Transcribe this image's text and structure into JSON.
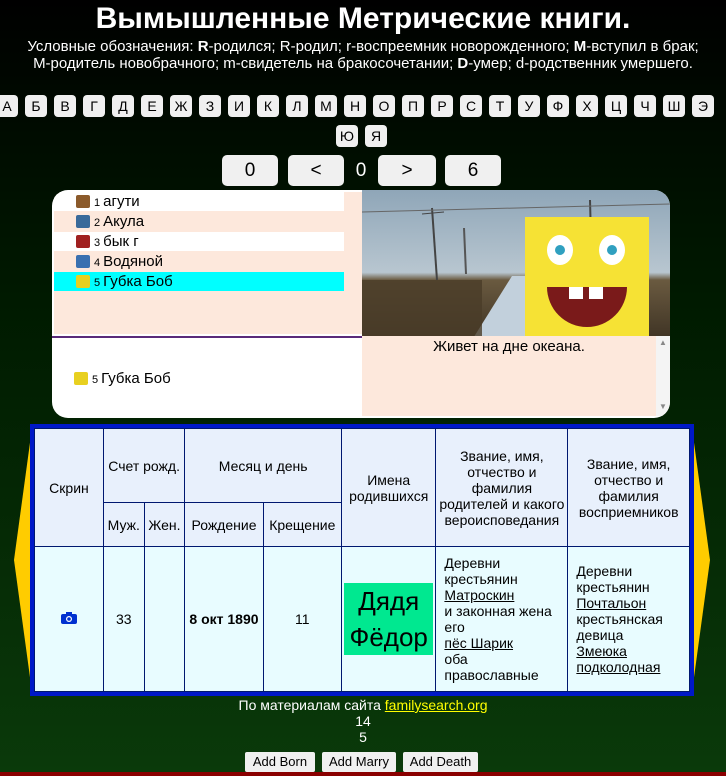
{
  "header": {
    "title": "Вымышленные Метрические книги.",
    "legend": [
      {
        "text": "Условные обозначения: ",
        "bold": false
      },
      {
        "text": "R",
        "bold": true
      },
      {
        "text": "-родился; R-родил; r-воспреемник новорожденного; ",
        "bold": false
      },
      {
        "text": "M",
        "bold": true
      },
      {
        "text": "-вступил в брак; M-родитель новобрачного; m-свидетель на бракосочетании; ",
        "bold": false
      },
      {
        "text": "D",
        "bold": true
      },
      {
        "text": "-умер; d-родственник умершего.",
        "bold": false
      }
    ]
  },
  "alphabet": [
    "А",
    "Б",
    "В",
    "Г",
    "Д",
    "Е",
    "Ж",
    "З",
    "И",
    "К",
    "Л",
    "М",
    "Н",
    "О",
    "П",
    "Р",
    "С",
    "Т",
    "У",
    "Ф",
    "Х",
    "Ц",
    "Ч",
    "Ш",
    "Э",
    "Ю",
    "Я"
  ],
  "nav": {
    "first": "0",
    "prev": "<",
    "current": "0",
    "next": ">",
    "last": "6"
  },
  "list": {
    "items": [
      {
        "num": "1",
        "label": "агути",
        "icon": "agouti-icon",
        "color": "#8b5a2b"
      },
      {
        "num": "2",
        "label": "Акула",
        "icon": "shark-icon",
        "color": "#3a6a9a"
      },
      {
        "num": "3",
        "label": "бык г",
        "icon": "bull-icon",
        "color": "#a02020"
      },
      {
        "num": "4",
        "label": "Водяной",
        "icon": "water-spirit-icon",
        "color": "#3a70b0"
      },
      {
        "num": "5",
        "label": "Губка Боб",
        "icon": "spongebob-icon",
        "color": "#e8d020"
      }
    ],
    "selected_index": 4,
    "selected_label": "Губка Боб",
    "selected_num": "5",
    "description": "Живет на дне океана."
  },
  "table": {
    "headers": {
      "screen": "Скрин",
      "birth_count": "Счет рожд.",
      "month_day": "Месяц и день",
      "names": "Имена родившихся",
      "parents": "Звание, имя, отчество и фамилия родителей и какого вероисповедания",
      "godparents": "Звание, имя, отчество и фамилия восприемников",
      "male": "Муж.",
      "female": "Жен.",
      "birth": "Рождение",
      "baptism": "Крещение"
    },
    "row": {
      "male_count": "33",
      "female_count": "",
      "birth_date": "8 окт 1890",
      "baptism_day": "11",
      "name": "Дядя Фёдор",
      "parents": {
        "line1": "Деревни крестьянин",
        "father": "Матроскин",
        "line2": "и законная жена его",
        "mother": "пёс Шарик",
        "line3": "оба православные"
      },
      "godparents": {
        "line1": "Деревни крестьянин",
        "godfather": "Почтальон",
        "line2": "крестьянская девица",
        "godmother": "Змеюка подколодная"
      }
    }
  },
  "footer": {
    "source_prefix": "По материалам сайта ",
    "source_link": "familysearch.org",
    "count1": "14",
    "count2": "5"
  },
  "actions": {
    "add_born": "Add Born",
    "add_marry": "Add Marry",
    "add_death": "Add Death"
  },
  "colors": {
    "table_border": "#0018c8",
    "selected_row": "#00ffff",
    "name_highlight": "#00e890",
    "wing": "#ffcc00",
    "link_yellow": "#ffff00"
  }
}
